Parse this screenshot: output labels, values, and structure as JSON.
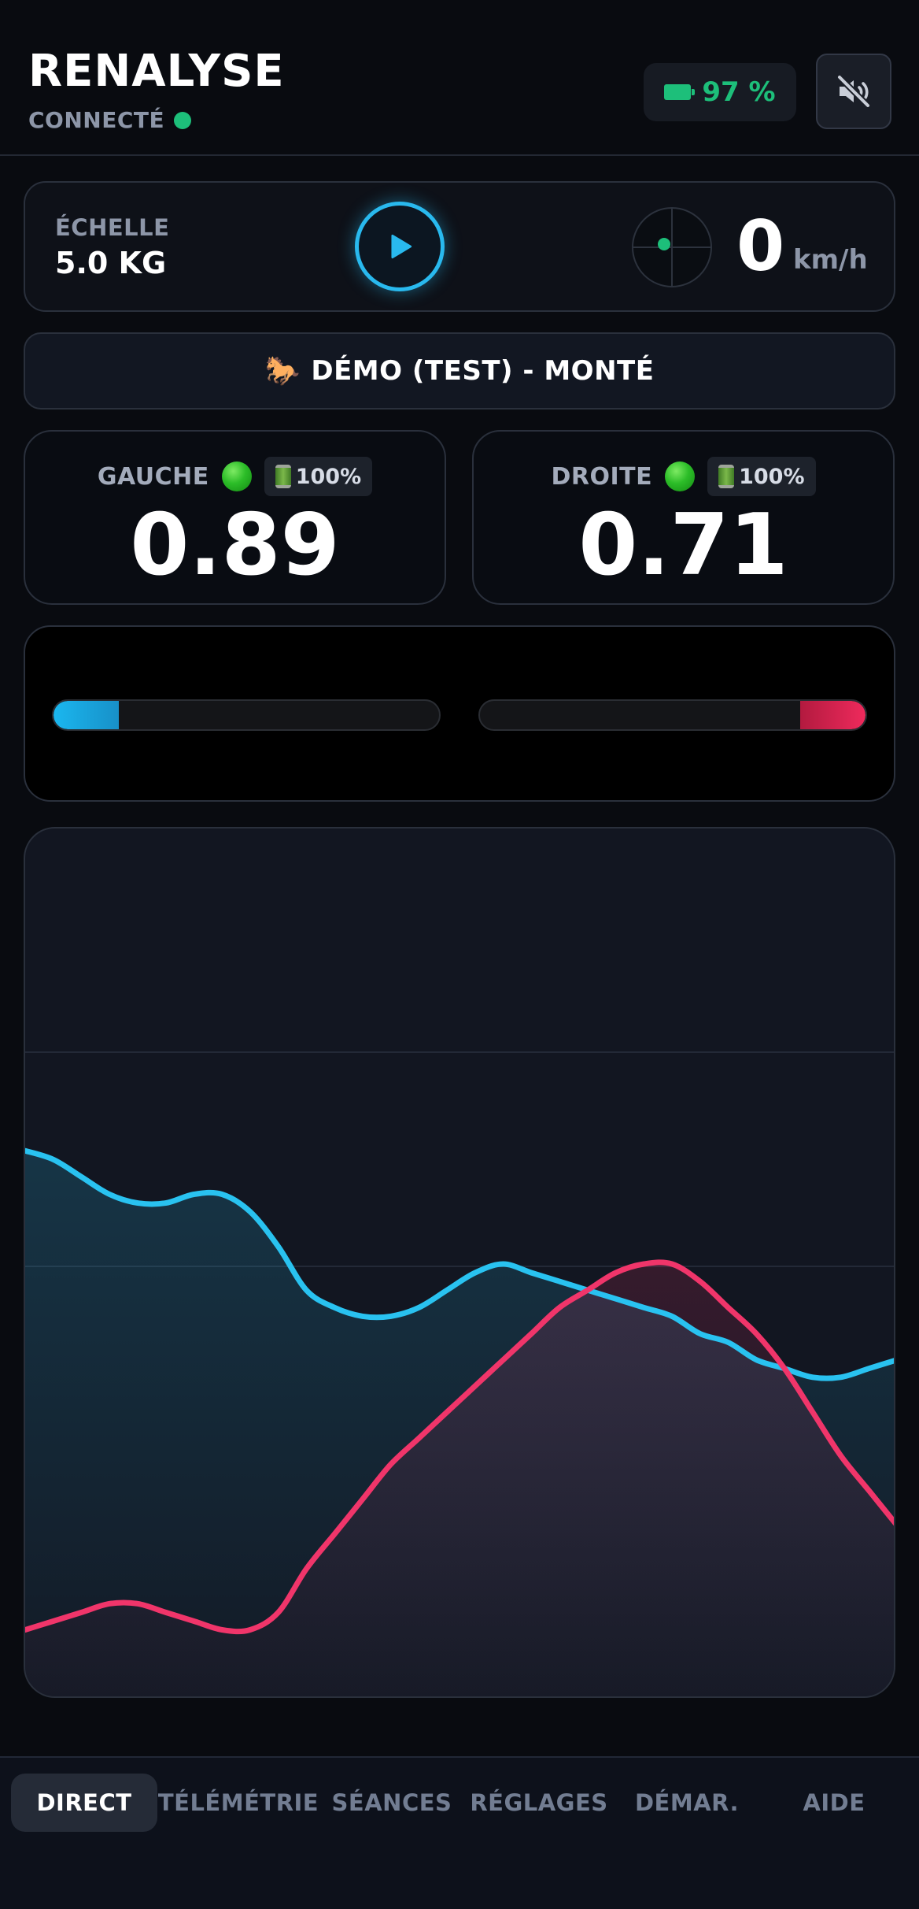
{
  "header": {
    "title": "RENALYSE",
    "connection_label": "CONNECTÉ",
    "connection_color": "#1dbf7a",
    "battery_text": "97 %",
    "battery_icon": "battery-icon",
    "mute_icon": "speaker-muted-icon"
  },
  "scale": {
    "label": "ÉCHELLE",
    "value": "5.0 KG",
    "play_icon": "play-icon",
    "gps_icon": "radar-icon",
    "speed_value": "0",
    "speed_unit": "km/h"
  },
  "mode": {
    "icon": "horse-icon",
    "glyph": "🐎",
    "label": "DÉMO (TEST) - MONTÉ"
  },
  "sensors": {
    "left": {
      "name": "GAUCHE",
      "battery": "100%",
      "value": "0.89",
      "status": "connected"
    },
    "right": {
      "name": "DROITE",
      "battery": "100%",
      "value": "0.71",
      "status": "connected"
    }
  },
  "balance": {
    "left_fraction": 0.17,
    "right_fraction": 0.17,
    "left_color": "#1ab7ef",
    "right_color": "#ee2a5c"
  },
  "graph": {
    "left_color": "#29c2f0",
    "right_color": "#f0356a",
    "left_series": [
      0.63,
      0.62,
      0.6,
      0.58,
      0.57,
      0.57,
      0.58,
      0.58,
      0.56,
      0.52,
      0.47,
      0.45,
      0.44,
      0.44,
      0.45,
      0.47,
      0.49,
      0.5,
      0.49,
      0.48,
      0.47,
      0.46,
      0.45,
      0.44,
      0.42,
      0.41,
      0.39,
      0.38,
      0.37,
      0.37,
      0.38,
      0.39
    ],
    "right_series": [
      0.08,
      0.09,
      0.1,
      0.11,
      0.11,
      0.1,
      0.09,
      0.08,
      0.08,
      0.1,
      0.15,
      0.19,
      0.23,
      0.27,
      0.3,
      0.33,
      0.36,
      0.39,
      0.42,
      0.45,
      0.47,
      0.49,
      0.5,
      0.5,
      0.48,
      0.45,
      0.42,
      0.38,
      0.33,
      0.28,
      0.24,
      0.2
    ]
  },
  "nav": {
    "items": [
      "DIRECT",
      "TÉLÉMÉTRIE",
      "SÉANCES",
      "RÉGLAGES",
      "DÉMAR.",
      "AIDE"
    ],
    "active": "DIRECT"
  }
}
